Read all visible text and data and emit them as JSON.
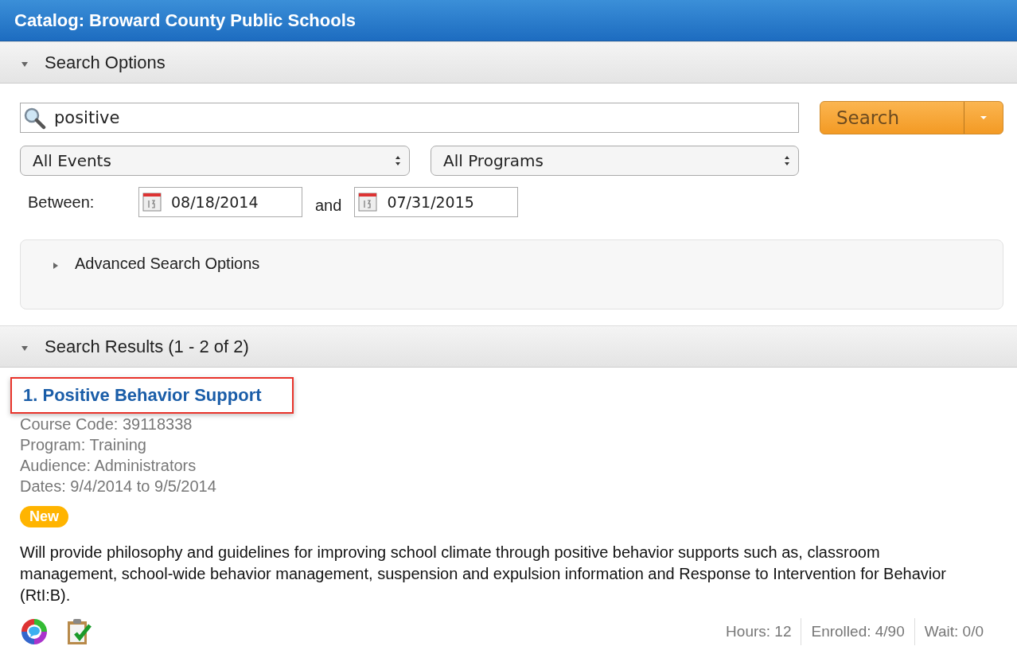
{
  "header": {
    "title": "Catalog: Broward County Public Schools"
  },
  "search_options": {
    "label": "Search Options",
    "expanded": true,
    "search_field": {
      "value": "positive"
    },
    "search_button": {
      "label": "Search"
    },
    "selects": [
      {
        "value": "All Events"
      },
      {
        "value": "All Programs"
      }
    ],
    "between_label": "Between:",
    "start_date": "08/18/2014",
    "and_label": "and",
    "end_date": "07/31/2015",
    "advanced": {
      "label": "Advanced Search Options",
      "expanded": false
    }
  },
  "search_results": {
    "label": "Search Results (1 - 2 of 2)",
    "expanded": true,
    "results": [
      {
        "title": "1. Positive Behavior Support",
        "highlighted": true,
        "details": [
          "Course Code: 39118338",
          "Program: Training",
          "Audience: Administrators",
          "Dates: 9/4/2014 to 9/5/2014"
        ],
        "badge": "New",
        "description": "Will provide philosophy and guidelines for improving school climate through positive behavior supports such as, classroom management, school-wide behavior management, suspension and expulsion information and Response to Intervention for Behavior (RtI:B).",
        "stats": [
          "Hours: 12",
          "Enrolled: 4/90",
          "Wait: 0/0"
        ]
      }
    ]
  }
}
